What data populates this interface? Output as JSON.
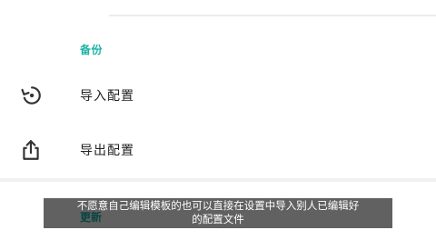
{
  "backup_section": {
    "header": "备份",
    "items": [
      {
        "label": "导入配置",
        "icon": "restore-icon"
      },
      {
        "label": "导出配置",
        "icon": "share-export-icon"
      }
    ]
  },
  "next_section": {
    "header": "更新"
  },
  "subtitle": {
    "line1": "不愿意自己编辑模板的也可以直接在设置中导入别人已编辑好",
    "line2": "的配置文件"
  },
  "colors": {
    "accent": "#1fb4a6",
    "text": "#222222",
    "divider": "#ececec"
  }
}
